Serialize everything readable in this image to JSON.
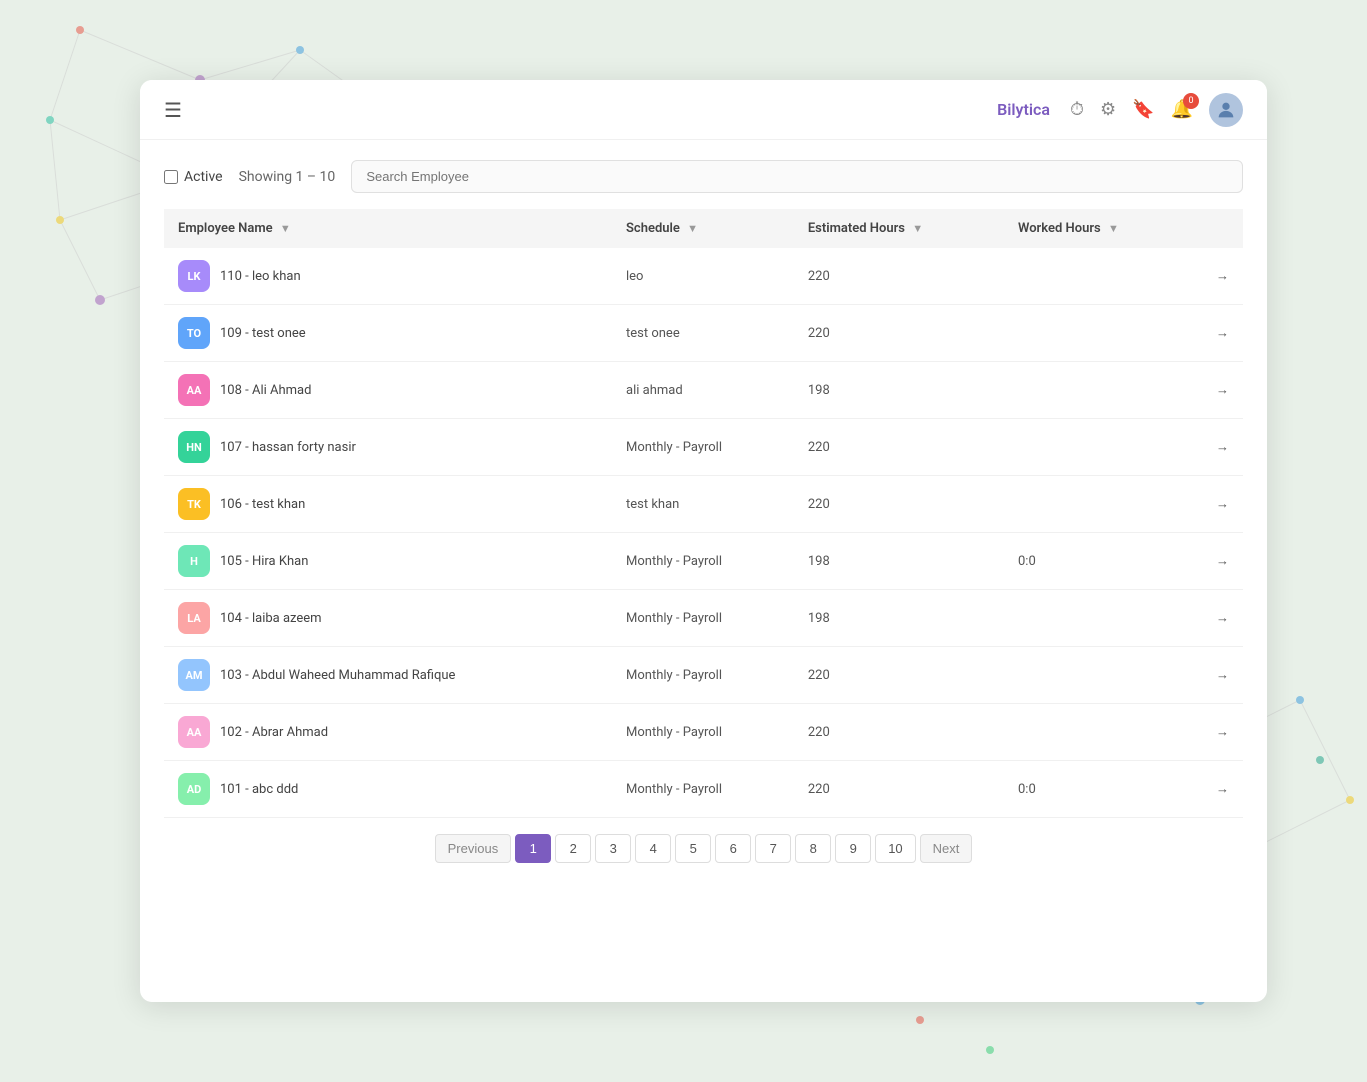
{
  "nav": {
    "hamburger_label": "☰",
    "brand": "Bilytica",
    "icons": {
      "clock": "⏱",
      "gear": "⚙",
      "bookmark": "🔖",
      "bell": "🔔",
      "bell_badge": "0"
    }
  },
  "filter": {
    "active_label": "Active",
    "showing_label": "Showing 1 – 10",
    "search_placeholder": "Search Employee"
  },
  "table": {
    "columns": [
      {
        "key": "employee_name",
        "label": "Employee Name"
      },
      {
        "key": "schedule",
        "label": "Schedule"
      },
      {
        "key": "estimated_hours",
        "label": "Estimated Hours"
      },
      {
        "key": "worked_hours",
        "label": "Worked Hours"
      }
    ],
    "rows": [
      {
        "id": "110",
        "initials": "LK",
        "name": "110 - leo khan",
        "schedule": "leo",
        "estimated": "220",
        "worked": "",
        "avatar_bg": "#a78bfa"
      },
      {
        "id": "109",
        "initials": "TO",
        "name": "109 - test onee",
        "schedule": "test onee",
        "estimated": "220",
        "worked": "",
        "avatar_bg": "#60a5fa"
      },
      {
        "id": "108",
        "initials": "AA",
        "name": "108 - Ali Ahmad",
        "schedule": "ali ahmad",
        "estimated": "198",
        "worked": "",
        "avatar_bg": "#f472b6"
      },
      {
        "id": "107",
        "initials": "HN",
        "name": "107 - hassan forty nasir",
        "schedule": "Monthly - Payroll",
        "estimated": "220",
        "worked": "",
        "avatar_bg": "#34d399"
      },
      {
        "id": "106",
        "initials": "TK",
        "name": "106 - test khan",
        "schedule": "test khan",
        "estimated": "220",
        "worked": "",
        "avatar_bg": "#fbbf24"
      },
      {
        "id": "105",
        "initials": "H",
        "name": "105 - Hira Khan",
        "schedule": "Monthly - Payroll",
        "estimated": "198",
        "worked": "0:0",
        "avatar_bg": "#6ee7b7"
      },
      {
        "id": "104",
        "initials": "LA",
        "name": "104 - laiba azeem",
        "schedule": "Monthly - Payroll",
        "estimated": "198",
        "worked": "",
        "avatar_bg": "#fca5a5"
      },
      {
        "id": "103",
        "initials": "AM",
        "name": "103 - Abdul Waheed Muhammad Rafique",
        "schedule": "Monthly - Payroll",
        "estimated": "220",
        "worked": "",
        "avatar_bg": "#93c5fd"
      },
      {
        "id": "102",
        "initials": "AA",
        "name": "102 - Abrar Ahmad",
        "schedule": "Monthly - Payroll",
        "estimated": "220",
        "worked": "",
        "avatar_bg": "#f9a8d4"
      },
      {
        "id": "101",
        "initials": "AD",
        "name": "101 - abc ddd",
        "schedule": "Monthly - Payroll",
        "estimated": "220",
        "worked": "0:0",
        "avatar_bg": "#86efac"
      }
    ]
  },
  "pagination": {
    "previous_label": "Previous",
    "next_label": "Next",
    "current_page": 1,
    "pages": [
      1,
      2,
      3,
      4,
      5,
      6,
      7,
      8,
      9,
      10
    ]
  }
}
